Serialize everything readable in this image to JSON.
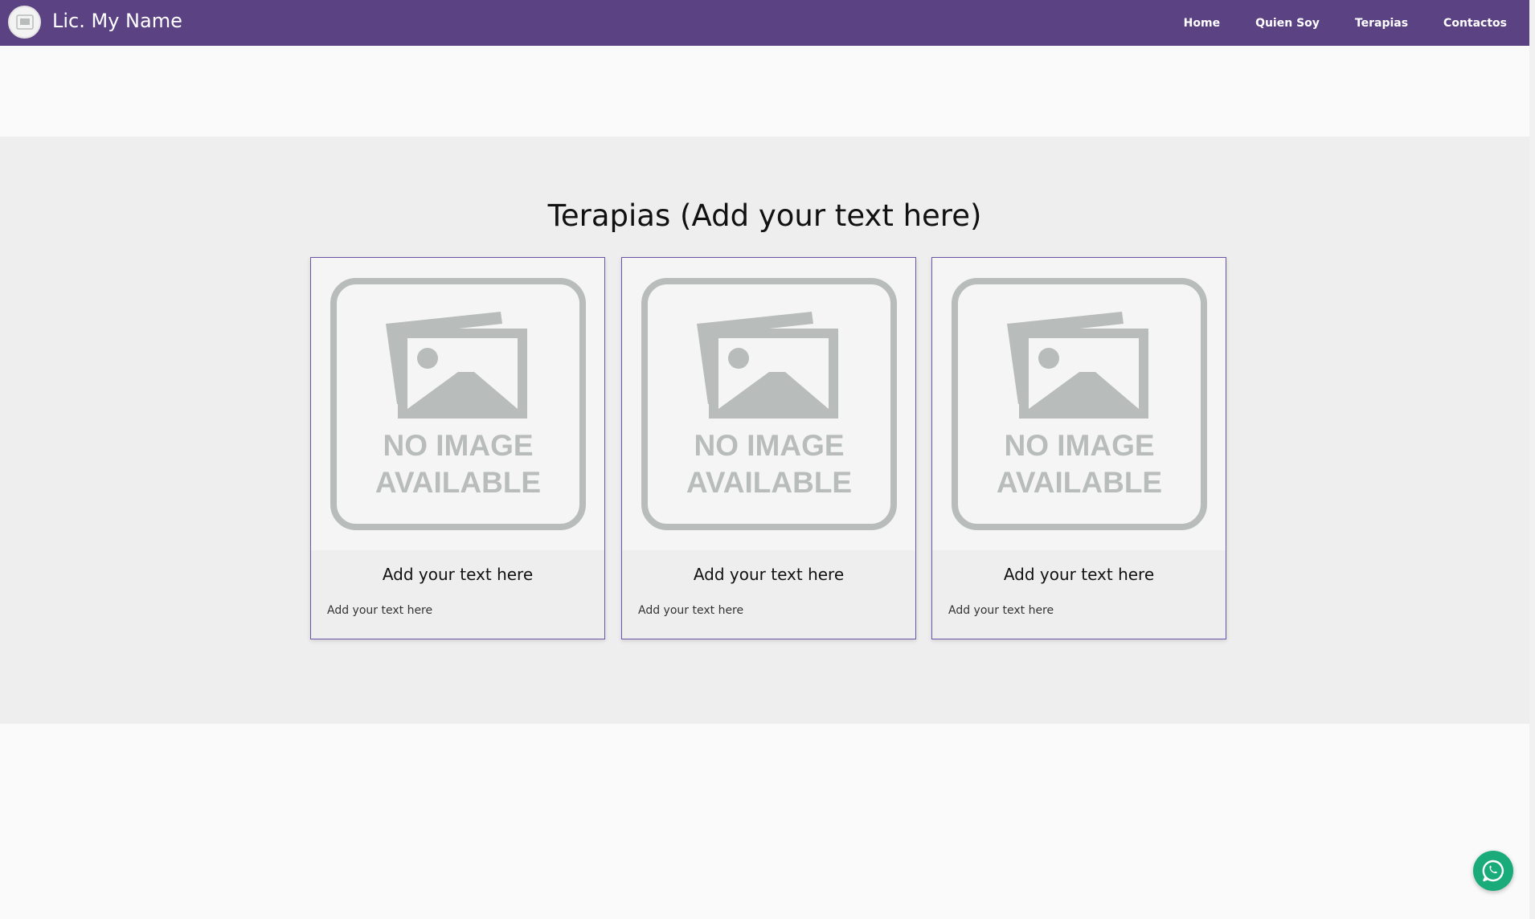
{
  "header": {
    "brand_name": "Lic. My Name",
    "nav": [
      {
        "label": "Home"
      },
      {
        "label": "Quien Soy"
      },
      {
        "label": "Terapias"
      },
      {
        "label": "Contactos"
      }
    ]
  },
  "section": {
    "title": "Terapias (Add your text here)",
    "cards": [
      {
        "image_text_1": "NO IMAGE",
        "image_text_2": "AVAILABLE",
        "title": "Add your text here",
        "text": "Add your text here"
      },
      {
        "image_text_1": "NO IMAGE",
        "image_text_2": "AVAILABLE",
        "title": "Add your text here",
        "text": "Add your text here"
      },
      {
        "image_text_1": "NO IMAGE",
        "image_text_2": "AVAILABLE",
        "title": "Add your text here",
        "text": "Add your text here"
      }
    ]
  },
  "icons": {
    "logo": "image-placeholder-icon",
    "float_button": "whatsapp-icon"
  },
  "colors": {
    "navbar": "#5b4282",
    "card_border": "#6a55a8",
    "whatsapp": "#1aab7a",
    "placeholder_gray": "#b8bcbb"
  }
}
